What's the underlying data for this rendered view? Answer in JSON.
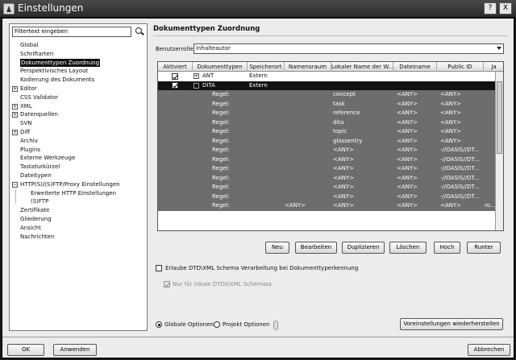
{
  "window": {
    "title": "Einstellungen",
    "controls": [
      "?",
      "X"
    ]
  },
  "filter": {
    "placeholder": "Filtertext eingeben"
  },
  "tree": [
    {
      "label": "Global",
      "level": 0
    },
    {
      "label": "Schriftarten",
      "level": 0
    },
    {
      "label": "Dokumenttypen Zuordnung",
      "level": 0,
      "selected": true
    },
    {
      "label": "Perspektivisches Layout",
      "level": 0
    },
    {
      "label": "Kodierung des Dokuments",
      "level": 0
    },
    {
      "label": "Editor",
      "level": 0,
      "expandable": true
    },
    {
      "label": "CSS Validator",
      "level": 0
    },
    {
      "label": "XML",
      "level": 0,
      "expandable": true
    },
    {
      "label": "Datenquellen",
      "level": 0,
      "expandable": true
    },
    {
      "label": "SVN",
      "level": 0
    },
    {
      "label": "Diff",
      "level": 0,
      "expandable": true
    },
    {
      "label": "Archiv",
      "level": 0
    },
    {
      "label": "Plugins",
      "level": 0
    },
    {
      "label": "Externe Werkzeuge",
      "level": 0
    },
    {
      "label": "Tastaturkürzel",
      "level": 0
    },
    {
      "label": "Dateitypen",
      "level": 0
    },
    {
      "label": "HTTP(S)/(S)FTP/Proxy Einstellungen",
      "level": 0,
      "expandable": true,
      "expanded": true
    },
    {
      "label": "Erweiterte HTTP Einstellungen",
      "level": 1
    },
    {
      "label": "(S)FTP",
      "level": 1
    },
    {
      "label": "Zertifikate",
      "level": 0
    },
    {
      "label": "Gliederung",
      "level": 0
    },
    {
      "label": "Ansicht",
      "level": 0
    },
    {
      "label": "Nachrichten",
      "level": 0
    }
  ],
  "panel": {
    "heading": "Dokumenttypen Zuordnung",
    "role_label": "Benutzerrolle:",
    "role_value": "Inhalteautor"
  },
  "table": {
    "columns": [
      "Aktiviert",
      "Dokumenttypen",
      "Speicherort",
      "Namensraum",
      "Lokaler Name der W...",
      "Dateiname",
      "Public ID",
      "Ja"
    ],
    "rows": [
      {
        "kind": "doctype",
        "checked": true,
        "name": "ANT",
        "location": "Extern",
        "style": "normal"
      },
      {
        "kind": "doctype",
        "checked": true,
        "name": "DITA",
        "location": "Extern",
        "style": "dark"
      },
      {
        "kind": "rule",
        "label": "Regel:",
        "ns": "",
        "local": "concept",
        "file": "<ANY>",
        "pub": "<ANY>",
        "extra": ""
      },
      {
        "kind": "rule",
        "label": "Regel:",
        "ns": "",
        "local": "task",
        "file": "<ANY>",
        "pub": "<ANY>",
        "extra": ""
      },
      {
        "kind": "rule",
        "label": "Regel:",
        "ns": "",
        "local": "reference",
        "file": "<ANY>",
        "pub": "<ANY>",
        "extra": ""
      },
      {
        "kind": "rule",
        "label": "Regel:",
        "ns": "",
        "local": "dita",
        "file": "<ANY>",
        "pub": "<ANY>",
        "extra": ""
      },
      {
        "kind": "rule",
        "label": "Regel:",
        "ns": "",
        "local": "topic",
        "file": "<ANY>",
        "pub": "<ANY>",
        "extra": ""
      },
      {
        "kind": "rule",
        "label": "Regel:",
        "ns": "",
        "local": "glossentry",
        "file": "<ANY>",
        "pub": "<ANY>",
        "extra": ""
      },
      {
        "kind": "rule",
        "label": "Regel:",
        "ns": "",
        "local": "<ANY>",
        "file": "<ANY>",
        "pub": "-//OASIS//DT...",
        "extra": ""
      },
      {
        "kind": "rule",
        "label": "Regel:",
        "ns": "",
        "local": "<ANY>",
        "file": "<ANY>",
        "pub": "-//OASIS//DT...",
        "extra": ""
      },
      {
        "kind": "rule",
        "label": "Regel:",
        "ns": "",
        "local": "<ANY>",
        "file": "<ANY>",
        "pub": "-//OASIS//DT...",
        "extra": ""
      },
      {
        "kind": "rule",
        "label": "Regel:",
        "ns": "",
        "local": "<ANY>",
        "file": "<ANY>",
        "pub": "-//OASIS//DT...",
        "extra": ""
      },
      {
        "kind": "rule",
        "label": "Regel:",
        "ns": "",
        "local": "<ANY>",
        "file": "<ANY>",
        "pub": "-//OASIS//DT...",
        "extra": ""
      },
      {
        "kind": "rule",
        "label": "Regel:",
        "ns": "",
        "local": "<ANY>",
        "file": "<ANY>",
        "pub": "-//OASIS//DT...",
        "extra": ""
      },
      {
        "kind": "rule",
        "label": "Regel:",
        "ns": "<ANY>",
        "local": "<ANY>",
        "file": "<ANY>",
        "pub": "<ANY>",
        "extra": "ro..."
      }
    ]
  },
  "buttons": {
    "new": "Neu",
    "edit": "Bearbeiten",
    "duplicate": "Duplizieren",
    "delete": "Löschen",
    "up": "Hoch",
    "down": "Runter"
  },
  "options": {
    "allow_dtd": "Erlaube DTD\\XML Schema Verarbeitung bei Dokumenttyperkennung",
    "allow_dtd_checked": false,
    "local_only": "Nur für lokale DTDs\\XML Schemata",
    "local_only_checked": true
  },
  "scope": {
    "global": "Globale Optionen",
    "project": "Projekt Optionen",
    "selected": "global",
    "restore": "Voreinstellungen wiederherstellen"
  },
  "footer": {
    "ok": "OK",
    "apply": "Anwenden",
    "cancel": "Abbrechen"
  }
}
